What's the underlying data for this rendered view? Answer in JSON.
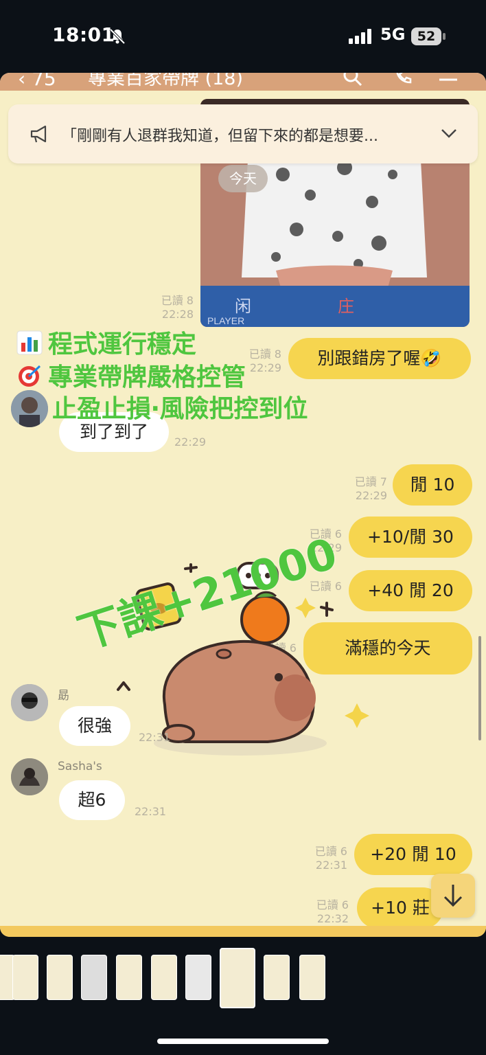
{
  "status_bar": {
    "time": "18:01",
    "network": "5G",
    "battery": "52"
  },
  "header": {
    "back_count": "75",
    "title": "專業百家帶牌 (18)"
  },
  "notice": {
    "text": "「剛剛有人退群我知道，但留下來的都是想要..."
  },
  "date_chip": "今天",
  "overlay_promo": {
    "line1": "程式運行穩定",
    "line2": "專業帶牌嚴格控管",
    "line3": "止盈止損‧風險把控到位",
    "icon1": "bar-chart-icon",
    "icon2": "target-icon"
  },
  "sticker_overlay": "下課+21000",
  "messages": [
    {
      "side": "out",
      "type": "image",
      "read": "已讀 8",
      "time": "22:28"
    },
    {
      "side": "out",
      "text": "別跟錯房了喔🤣",
      "read": "已讀 8",
      "time": "22:29"
    },
    {
      "side": "in",
      "text": "到了到了",
      "time": "22:29"
    },
    {
      "side": "out",
      "text": "閒 10",
      "read": "已讀 7",
      "time": "22:29"
    },
    {
      "side": "out",
      "text": "+10/閒 30",
      "read": "已讀 6",
      "time": "22:29"
    },
    {
      "side": "out",
      "text": "+40 閒 20",
      "read": "已讀 6",
      "time": ""
    },
    {
      "side": "out",
      "text": "滿穩的今天",
      "read": "已讀 6",
      "time": ""
    },
    {
      "side": "in",
      "sender": "勗",
      "text": "很強",
      "time": "22:31"
    },
    {
      "side": "in",
      "sender": "Sasha's",
      "text": "超6",
      "time": "22:31"
    },
    {
      "side": "out",
      "text": "+20 閒 10",
      "read": "已讀 6",
      "time": "22:31"
    },
    {
      "side": "out",
      "text": "+10 莊",
      "read": "已讀 6",
      "time": "22:32"
    }
  ],
  "colors": {
    "chat_bg": "#f7efc6",
    "bubble_out": "#f6d54f",
    "bubble_in": "#ffffff",
    "header": "#d8a27a",
    "overlay_text": "#4fc63f"
  }
}
